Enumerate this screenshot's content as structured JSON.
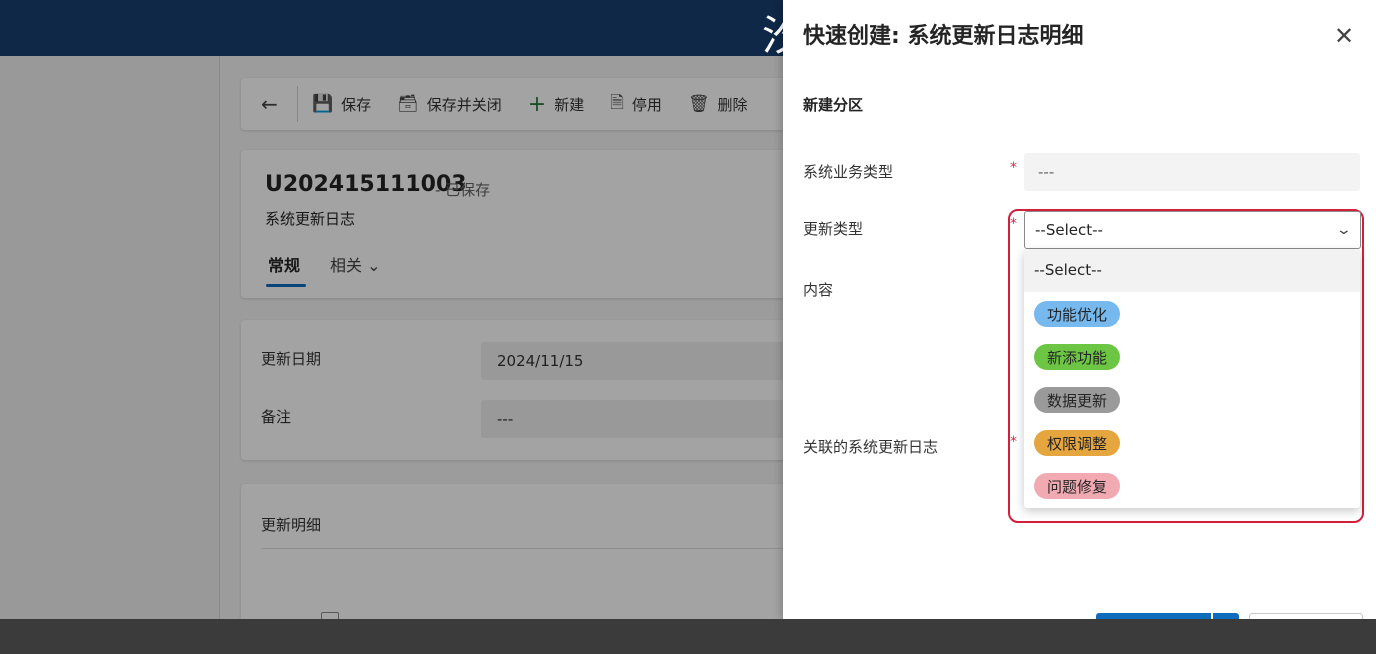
{
  "background_app": {
    "topbar_glyph": "汐",
    "command_bar": {
      "save": "保存",
      "save_close": "保存并关闭",
      "new": "新建",
      "deactivate": "停用",
      "delete": "删除"
    },
    "record": {
      "title": "U202415111003",
      "status": "- 已保存",
      "entity": "系统更新日志"
    },
    "tabs": {
      "general": "常规",
      "related": "相关"
    },
    "fields": {
      "update_date_label": "更新日期",
      "update_date_value": "2024/11/15",
      "remark_label": "备注",
      "remark_value": "---"
    },
    "detail_section": {
      "title": "更新明细"
    }
  },
  "panel": {
    "title": "快速创建: 系统更新日志明细",
    "section_title": "新建分区",
    "required_mark": "*",
    "business_type": {
      "label": "系统业务类型",
      "value": "---"
    },
    "update_type": {
      "label": "更新类型",
      "selected": "--Select--",
      "options": [
        {
          "label": "--Select--"
        },
        {
          "label": "功能优化",
          "color": "#76b9ee"
        },
        {
          "label": "新添功能",
          "color": "#6cc644"
        },
        {
          "label": "数据更新",
          "color": "#9a9a9a"
        },
        {
          "label": "权限调整",
          "color": "#e5a640"
        },
        {
          "label": "问题修复",
          "color": "#f2aab2"
        }
      ]
    },
    "content_label": "内容",
    "related_log_label": "关联的系统更新日志"
  },
  "colors": {
    "topbar": "#0f2847",
    "accent": "#0f6cbd",
    "required": "#c4314b",
    "highlight": "#d21f3c"
  }
}
